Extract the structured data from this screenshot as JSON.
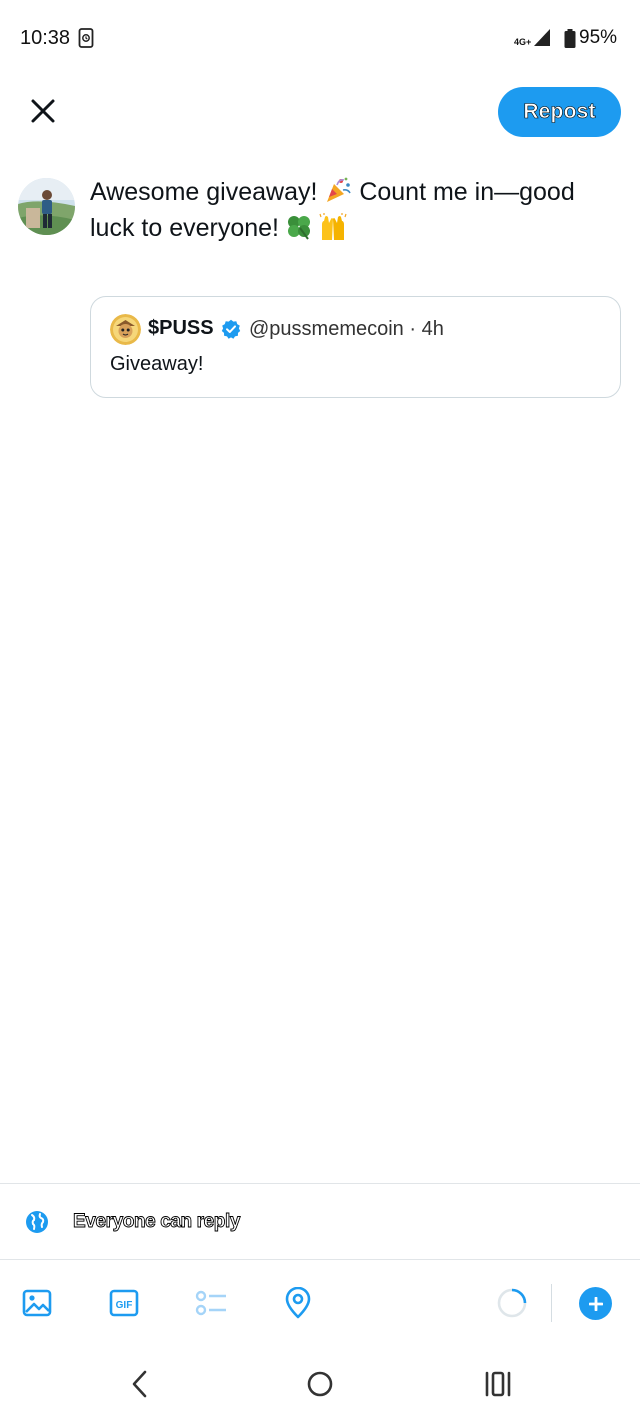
{
  "status_bar": {
    "time": "10:38",
    "network": "4G+",
    "battery": "95%"
  },
  "header": {
    "close_icon": "close-x-icon",
    "repost_label": "Repost"
  },
  "compose": {
    "line1": "Awesome giveaway! ",
    "line1b": " Count me in—good",
    "line2": "luck to everyone! ",
    "emojis": [
      "party-popper",
      "four-leaf-clover",
      "raising-hands"
    ]
  },
  "quote": {
    "name": "$PUSS",
    "handle": "@pussmemecoin · 4h",
    "body": "Giveaway!",
    "verified": true
  },
  "reply_setting": {
    "label": "Everyone can reply",
    "icon": "globe-icon"
  },
  "toolbar": {
    "items": [
      "image-icon",
      "gif-icon",
      "poll-icon",
      "location-icon",
      "char-progress-ring",
      "add-icon"
    ],
    "gif_label": "GIF"
  },
  "colors": {
    "accent": "#1d9bf0",
    "border": "#cfd9de",
    "text": "#0f1419"
  }
}
